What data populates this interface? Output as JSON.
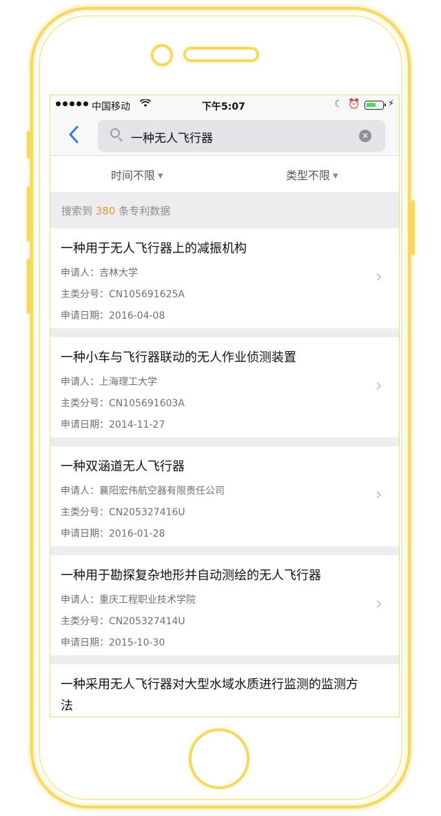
{
  "status_bar": {
    "carrier": "中国移动",
    "time": "下午5:07"
  },
  "search": {
    "query": "一种无人飞行器",
    "clear_icon": "clear-icon"
  },
  "filters": [
    {
      "label": "时间不限"
    },
    {
      "label": "类型不限"
    }
  ],
  "result_count": {
    "prefix": "搜索到 ",
    "number": "380",
    "suffix": " 条专利数据"
  },
  "results": [
    {
      "title": "一种用于无人飞行器上的减振机构",
      "applicant": "申请人：吉林大学",
      "class_no": "主类分号：CN105691625A",
      "date": "申请日期：2016-04-08"
    },
    {
      "title": "一种小车与飞行器联动的无人作业侦测装置",
      "applicant": "申请人：上海理工大学",
      "class_no": "主类分号：CN105691603A",
      "date": "申请日期：2014-11-27"
    },
    {
      "title": "一种双涵道无人飞行器",
      "applicant": "申请人：襄阳宏伟航空器有限责任公司",
      "class_no": "主类分号：CN205327416U",
      "date": "申请日期：2016-01-28"
    },
    {
      "title": "一种用于勘探复杂地形并自动测绘的无人飞行器",
      "applicant": "申请人：重庆工程职业技术学院",
      "class_no": "主类分号：CN205327414U",
      "date": "申请日期：2015-10-30"
    },
    {
      "title": "一种采用无人飞行器对大型水域水质进行监测的监测方法"
    }
  ],
  "colors": {
    "accent": "#2a7fd4",
    "count_highlight": "#e69a2e",
    "frame": "#f3d95f",
    "battery": "#4cd964"
  }
}
